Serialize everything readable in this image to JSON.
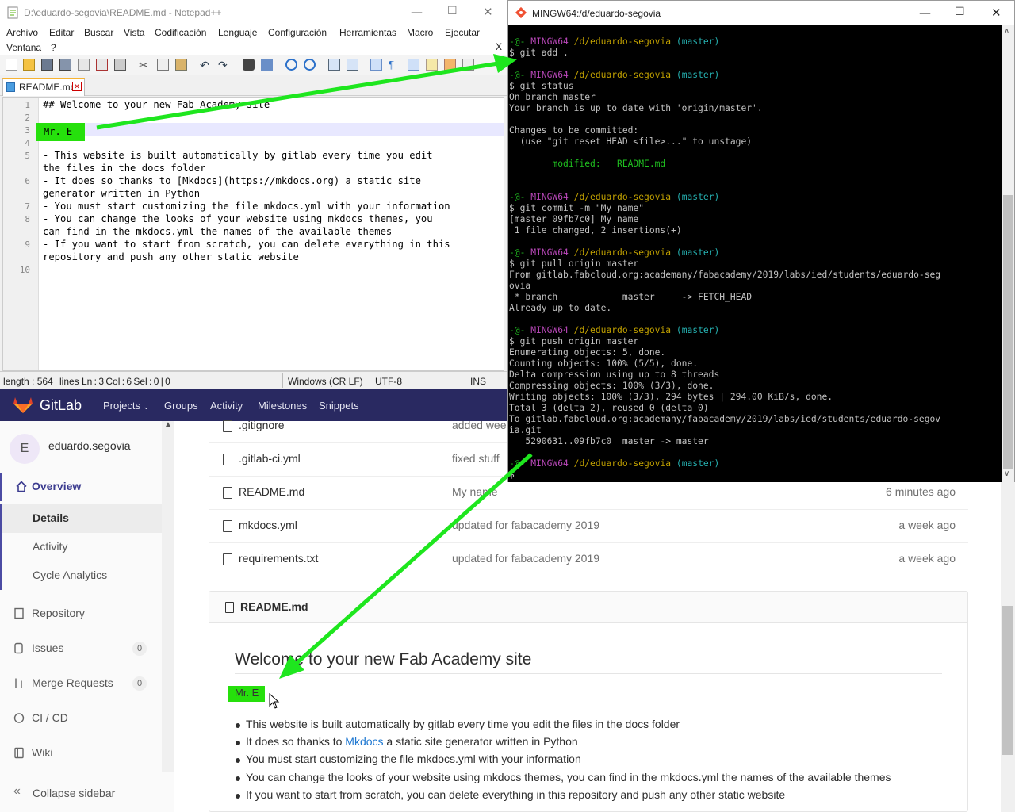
{
  "notepad": {
    "title": "D:\\eduardo-segovia\\README.md - Notepad++",
    "menu": [
      "Archivo",
      "Editar",
      "Buscar",
      "Vista",
      "Codificación",
      "Lenguaje",
      "Configuración",
      "Herramientas",
      "Macro",
      "Ejecutar",
      "Ventana",
      "?"
    ],
    "close_x": "X",
    "tab": "README.md",
    "lines": [
      {
        "n": "1",
        "text": "## Welcome to your new Fab Academy site"
      },
      {
        "n": "2",
        "text": ""
      },
      {
        "n": "3",
        "text": "Mr. E"
      },
      {
        "n": "4",
        "text": ""
      },
      {
        "n": "5",
        "text": "- This website is built automatically by gitlab every time you edit"
      },
      {
        "n": "",
        "text": "the files in the docs folder"
      },
      {
        "n": "6",
        "text": "- It does so thanks to [Mkdocs](https://mkdocs.org) a static site"
      },
      {
        "n": "",
        "text": "generator written in Python"
      },
      {
        "n": "7",
        "text": "- You must start customizing the file mkdocs.yml with your information"
      },
      {
        "n": "8",
        "text": "- You can change the looks of your website using mkdocs themes, you"
      },
      {
        "n": "",
        "text": "can find in the mkdocs.yml the names of the available themes"
      },
      {
        "n": "9",
        "text": "- If you want to start from scratch, you can delete everything in this"
      },
      {
        "n": "",
        "text": "repository and push any other static website"
      },
      {
        "n": "10",
        "text": ""
      }
    ],
    "status": {
      "length": "length : 564",
      "lines": "lines",
      "pos": "Ln : 3    Col : 6    Sel : 0 | 0",
      "eol": "Windows (CR LF)",
      "enc": "UTF-8",
      "mode": "INS"
    }
  },
  "bash": {
    "title": "MINGW64:/d/eduardo-segovia",
    "prompt": {
      "user": "-@-",
      "host": "MINGW64",
      "path": "/d/eduardo-segovia",
      "branch": "(master)"
    },
    "lines": [
      {
        "t": "prompt"
      },
      {
        "t": "text",
        "v": "$ git add ."
      },
      {
        "t": "blank"
      },
      {
        "t": "prompt"
      },
      {
        "t": "text",
        "v": "$ git status"
      },
      {
        "t": "text",
        "v": "On branch master"
      },
      {
        "t": "text",
        "v": "Your branch is up to date with 'origin/master'."
      },
      {
        "t": "blank"
      },
      {
        "t": "text",
        "v": "Changes to be committed:"
      },
      {
        "t": "text",
        "v": "  (use \"git reset HEAD <file>...\" to unstage)"
      },
      {
        "t": "blank"
      },
      {
        "t": "green",
        "v": "        modified:   README.md"
      },
      {
        "t": "blank"
      },
      {
        "t": "blank"
      },
      {
        "t": "prompt"
      },
      {
        "t": "text",
        "v": "$ git commit -m \"My name\""
      },
      {
        "t": "text",
        "v": "[master 09fb7c0] My name"
      },
      {
        "t": "text",
        "v": " 1 file changed, 2 insertions(+)"
      },
      {
        "t": "blank"
      },
      {
        "t": "prompt"
      },
      {
        "t": "text",
        "v": "$ git pull origin master"
      },
      {
        "t": "text",
        "v": "From gitlab.fabcloud.org:academany/fabacademy/2019/labs/ied/students/eduardo-seg"
      },
      {
        "t": "text",
        "v": "ovia"
      },
      {
        "t": "text",
        "v": " * branch            master     -> FETCH_HEAD"
      },
      {
        "t": "text",
        "v": "Already up to date."
      },
      {
        "t": "blank"
      },
      {
        "t": "prompt"
      },
      {
        "t": "text",
        "v": "$ git push origin master"
      },
      {
        "t": "text",
        "v": "Enumerating objects: 5, done."
      },
      {
        "t": "text",
        "v": "Counting objects: 100% (5/5), done."
      },
      {
        "t": "text",
        "v": "Delta compression using up to 8 threads"
      },
      {
        "t": "text",
        "v": "Compressing objects: 100% (3/3), done."
      },
      {
        "t": "text",
        "v": "Writing objects: 100% (3/3), 294 bytes | 294.00 KiB/s, done."
      },
      {
        "t": "text",
        "v": "Total 3 (delta 2), reused 0 (delta 0)"
      },
      {
        "t": "text",
        "v": "To gitlab.fabcloud.org:academany/fabacademy/2019/labs/ied/students/eduardo-segov"
      },
      {
        "t": "text",
        "v": "ia.git"
      },
      {
        "t": "text",
        "v": "   5290631..09fb7c0  master -> master"
      },
      {
        "t": "blank"
      },
      {
        "t": "prompt"
      },
      {
        "t": "text",
        "v": "$"
      }
    ]
  },
  "gitlab": {
    "brand": "GitLab",
    "nav": [
      "Projects",
      "Groups",
      "Activity",
      "Milestones",
      "Snippets"
    ],
    "user_initial": "E",
    "username": "eduardo.segovia",
    "sidebar": {
      "overview": "Overview",
      "details": "Details",
      "activity": "Activity",
      "cycle": "Cycle Analytics",
      "repository": "Repository",
      "issues": "Issues",
      "issues_count": "0",
      "merge": "Merge Requests",
      "merge_count": "0",
      "cicd": "CI / CD",
      "wiki": "Wiki",
      "collapse": "Collapse sidebar"
    },
    "files": [
      {
        "name": ".gitignore",
        "msg": "added week",
        "time": ""
      },
      {
        "name": ".gitlab-ci.yml",
        "msg": "fixed stuff",
        "time": ""
      },
      {
        "name": "README.md",
        "msg": "My name",
        "time": "6 minutes ago"
      },
      {
        "name": "mkdocs.yml",
        "msg": "updated for fabacademy 2019",
        "time": "a week ago"
      },
      {
        "name": "requirements.txt",
        "msg": "updated for fabacademy 2019",
        "time": "a week ago"
      }
    ],
    "readme": {
      "file": "README.md",
      "heading": "Welcome to your new Fab Academy site",
      "name": "Mr. E",
      "b1": "This website is built automatically by gitlab every time you edit the files in the docs folder",
      "b2_pre": "It does so thanks to ",
      "b2_link": "Mkdocs",
      "b2_post": " a static site generator written in Python",
      "b3": "You must start customizing the file mkdocs.yml with your information",
      "b4": "You can change the looks of your website using mkdocs themes, you can find in the mkdocs.yml the names of the available themes",
      "b5": "If you want to start from scratch, you can delete everything in this repository and push any other static website"
    }
  },
  "colors": {
    "highlight": "#26e00c",
    "arrow": "#1ee61e",
    "gitlab_nav": "#292961"
  }
}
